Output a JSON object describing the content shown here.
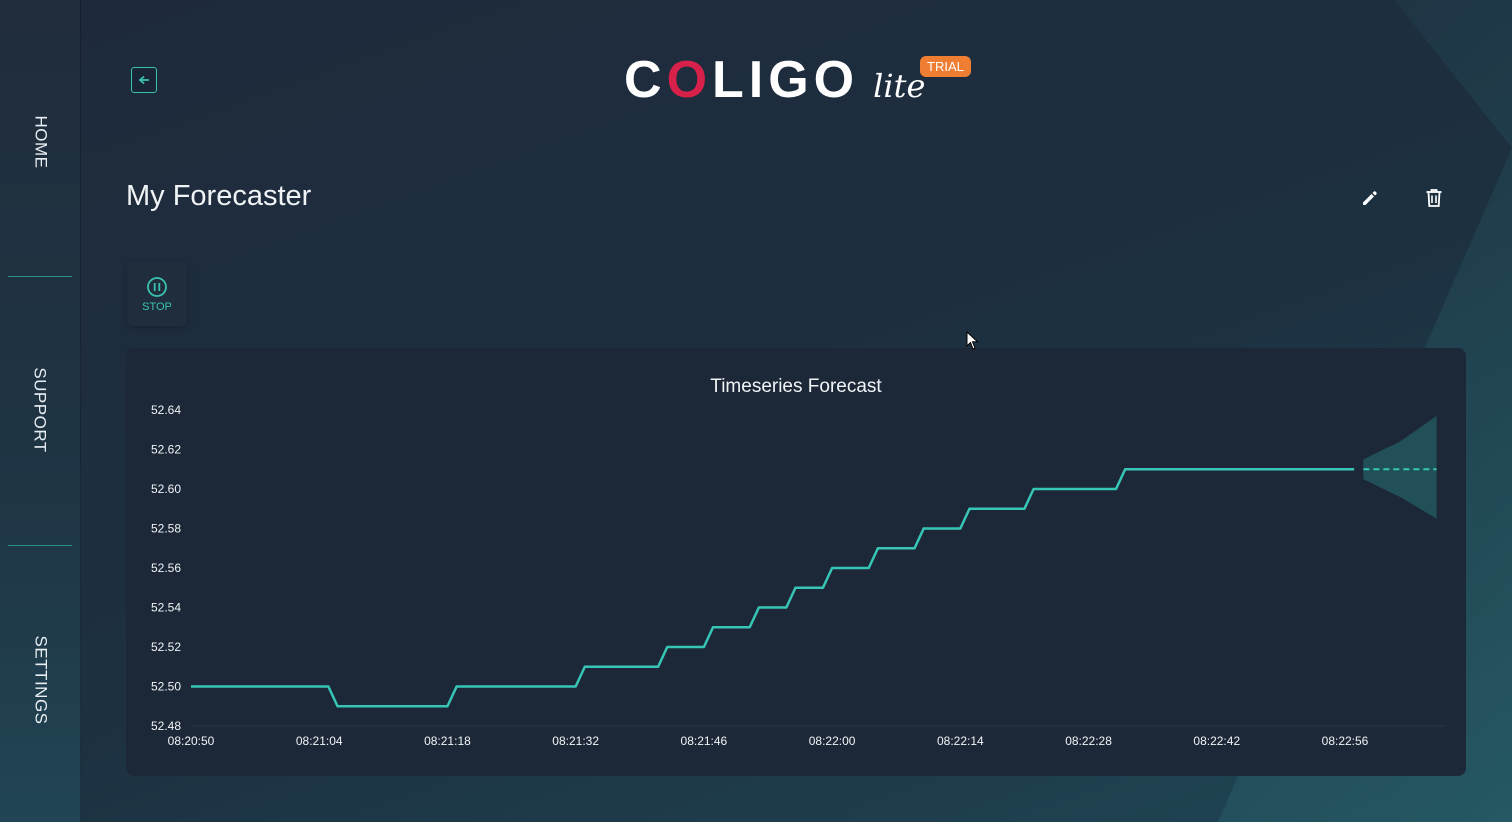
{
  "sidebar": {
    "items": [
      {
        "label": "HOME"
      },
      {
        "label": "SUPPORT"
      },
      {
        "label": "SETTINGS"
      }
    ]
  },
  "header": {
    "logo_text_left": "C",
    "logo_text_o": "O",
    "logo_text_right": "LIGO",
    "logo_lite": "lite",
    "badge": "TRIAL"
  },
  "page": {
    "title": "My Forecaster"
  },
  "controls": {
    "stop_label": "STOP"
  },
  "colors": {
    "accent": "#39c2b1",
    "badge": "#ef7d32",
    "logo_red": "#d8214a",
    "card": "#1c2838"
  },
  "icons": [
    "back-icon",
    "edit-icon",
    "trash-icon",
    "pause-icon"
  ],
  "chart_data": {
    "type": "line",
    "title": "Timeseries Forecast",
    "xlabel": "",
    "ylabel": "",
    "ylim": [
      52.48,
      52.64
    ],
    "yticks": [
      "52.64",
      "52.62",
      "52.60",
      "52.58",
      "52.56",
      "52.54",
      "52.52",
      "52.50",
      "52.48"
    ],
    "xticks": [
      "08:20:50",
      "08:21:04",
      "08:21:18",
      "08:21:32",
      "08:21:46",
      "08:22:00",
      "08:22:14",
      "08:22:28",
      "08:22:42",
      "08:22:56"
    ],
    "grid": false,
    "series": [
      {
        "values": [
          [
            "08:20:50",
            52.5
          ],
          [
            "08:21:05",
            52.5
          ],
          [
            "08:21:06",
            52.49
          ],
          [
            "08:21:18",
            52.49
          ],
          [
            "08:21:19",
            52.5
          ],
          [
            "08:21:32",
            52.5
          ],
          [
            "08:21:33",
            52.51
          ],
          [
            "08:21:41",
            52.51
          ],
          [
            "08:21:42",
            52.52
          ],
          [
            "08:21:46",
            52.52
          ],
          [
            "08:21:47",
            52.53
          ],
          [
            "08:21:51",
            52.53
          ],
          [
            "08:21:52",
            52.54
          ],
          [
            "08:21:55",
            52.54
          ],
          [
            "08:21:56",
            52.55
          ],
          [
            "08:21:59",
            52.55
          ],
          [
            "08:22:00",
            52.56
          ],
          [
            "08:22:04",
            52.56
          ],
          [
            "08:22:05",
            52.57
          ],
          [
            "08:22:09",
            52.57
          ],
          [
            "08:22:10",
            52.58
          ],
          [
            "08:22:14",
            52.58
          ],
          [
            "08:22:15",
            52.59
          ],
          [
            "08:22:21",
            52.59
          ],
          [
            "08:22:22",
            52.6
          ],
          [
            "08:22:31",
            52.6
          ],
          [
            "08:22:32",
            52.61
          ],
          [
            "08:22:57",
            52.61
          ]
        ]
      },
      {
        "dashed": true,
        "values": [
          [
            "08:22:58",
            52.61
          ],
          [
            "08:23:06",
            52.61
          ]
        ]
      }
    ],
    "interval": {
      "values": [
        {
          "t": "08:22:58",
          "low": 52.605,
          "high": 52.615
        },
        {
          "t": "08:23:02",
          "low": 52.596,
          "high": 52.624
        },
        {
          "t": "08:23:06",
          "low": 52.585,
          "high": 52.637
        }
      ]
    }
  }
}
